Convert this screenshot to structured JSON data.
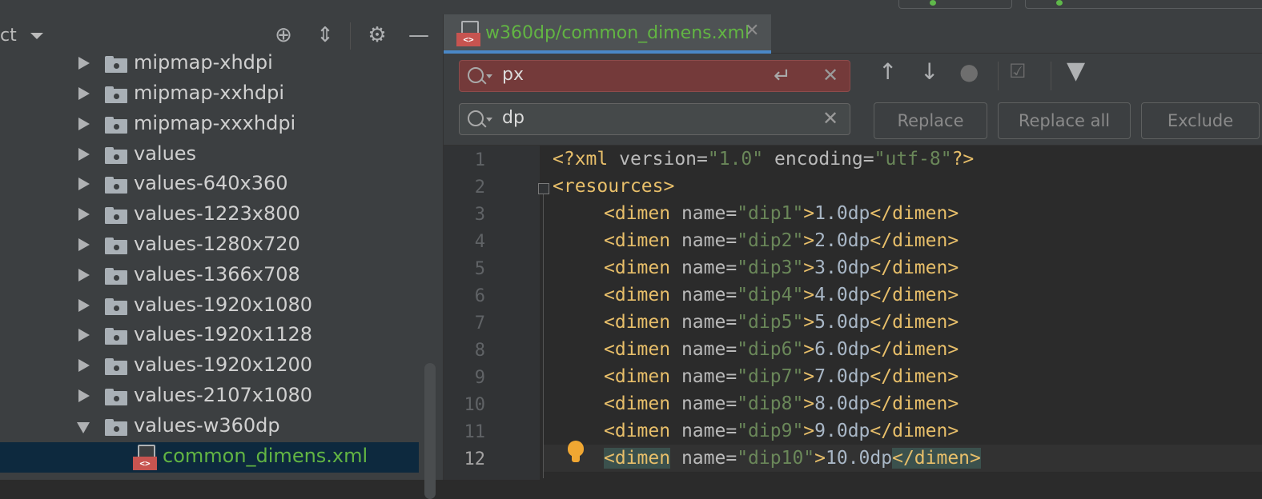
{
  "project_panel": {
    "title": "ct",
    "tree": [
      {
        "label": "mipmap-xhdpi",
        "expanded": false
      },
      {
        "label": "mipmap-xxhdpi",
        "expanded": false
      },
      {
        "label": "mipmap-xxxhdpi",
        "expanded": false
      },
      {
        "label": "values",
        "expanded": false
      },
      {
        "label": "values-640x360",
        "expanded": false
      },
      {
        "label": "values-1223x800",
        "expanded": false
      },
      {
        "label": "values-1280x720",
        "expanded": false
      },
      {
        "label": "values-1366x708",
        "expanded": false
      },
      {
        "label": "values-1920x1080",
        "expanded": false
      },
      {
        "label": "values-1920x1128",
        "expanded": false
      },
      {
        "label": "values-1920x1200",
        "expanded": false
      },
      {
        "label": "values-2107x1080",
        "expanded": false
      },
      {
        "label": "values-w360dp",
        "expanded": true
      }
    ],
    "selected_file": "common_dimens.xml"
  },
  "editor": {
    "tab_label": "w360dp/common_dimens.xml",
    "find": {
      "search_value": "px",
      "replace_value": "dp",
      "search_has_no_match": true
    },
    "buttons": {
      "replace": "Replace",
      "replace_all": "Replace all",
      "exclude": "Exclude"
    },
    "line_numbers": [
      "1",
      "2",
      "3",
      "4",
      "5",
      "6",
      "7",
      "8",
      "9",
      "10",
      "11",
      "12"
    ],
    "current_line": "12",
    "header_line": {
      "decl_open": "<?xml",
      "version_attr": " version",
      "eq1": "=",
      "version_val": "\"1.0\"",
      "encoding_attr": " encoding",
      "eq2": "=",
      "encoding_val": "\"utf-8\"",
      "decl_close": "?>"
    },
    "resources_line": "<resources>",
    "dimens": [
      {
        "name": "\"dip1\"",
        "value": "1.0dp"
      },
      {
        "name": "\"dip2\"",
        "value": "2.0dp"
      },
      {
        "name": "\"dip3\"",
        "value": "3.0dp"
      },
      {
        "name": "\"dip4\"",
        "value": "4.0dp"
      },
      {
        "name": "\"dip5\"",
        "value": "5.0dp"
      },
      {
        "name": "\"dip6\"",
        "value": "6.0dp"
      },
      {
        "name": "\"dip7\"",
        "value": "7.0dp"
      },
      {
        "name": "\"dip8\"",
        "value": "8.0dp"
      },
      {
        "name": "\"dip9\"",
        "value": "9.0dp"
      },
      {
        "name": "\"dip10\"",
        "value": "10.0dp"
      }
    ],
    "tokens": {
      "open_tag": "<dimen",
      "attr": " name",
      "eq": "=",
      "gt": ">",
      "close_tag": "</dimen>"
    }
  },
  "colors": {
    "accent": "#4a88c7",
    "green_file": "#62b543",
    "error_field": "#743a3a"
  }
}
